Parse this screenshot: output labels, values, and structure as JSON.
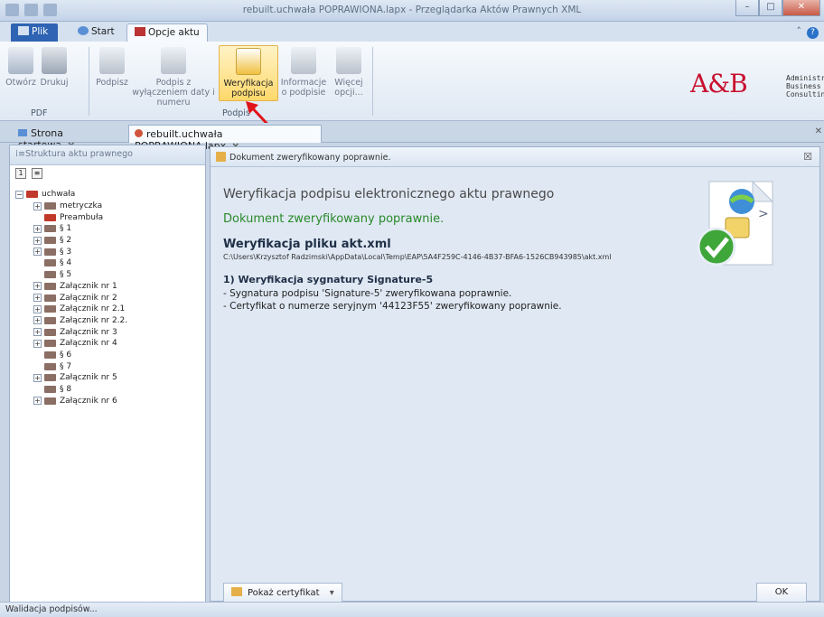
{
  "window": {
    "title": "rebuilt.uchwała POPRAWIONA.lapx - Przeglądarka Aktów Prawnych XML"
  },
  "ribbon_tabs": [
    {
      "label": "Plik"
    },
    {
      "label": "Start"
    },
    {
      "label": "Opcje aktu"
    }
  ],
  "ribbon": {
    "buttons": [
      {
        "label": "Otwórz"
      },
      {
        "label": "Drukuj"
      },
      {
        "label": "Podpisz"
      },
      {
        "label": "Podpis z wyłączeniem daty i numeru"
      },
      {
        "label": "Weryfikacja podpisu"
      },
      {
        "label": "Informacje o podpisie"
      },
      {
        "label": "Więcej opcji..."
      }
    ],
    "groups": {
      "pdf": "PDF",
      "podpis": "Podpis"
    }
  },
  "logo": {
    "mark": "A&B",
    "text": "Administration & Business Consulting"
  },
  "doc_tabs": [
    {
      "label": "Strona startowa"
    },
    {
      "label": "rebuilt.uchwała POPRAWIONA.lapx"
    }
  ],
  "left_panel": {
    "title": "Struktura aktu prawnego",
    "tree": [
      {
        "label": "uchwała",
        "level": 0,
        "expander": "−",
        "red": true
      },
      {
        "label": "metryczka",
        "level": 1,
        "expander": "+",
        "red": false
      },
      {
        "label": "Preambuła",
        "level": 1,
        "expander": "",
        "red": true
      },
      {
        "label": "§ 1",
        "level": 1,
        "expander": "+",
        "red": false
      },
      {
        "label": "§ 2",
        "level": 1,
        "expander": "+",
        "red": false
      },
      {
        "label": "§ 3",
        "level": 1,
        "expander": "+",
        "red": false
      },
      {
        "label": "§ 4",
        "level": 1,
        "expander": "",
        "red": false
      },
      {
        "label": "§ 5",
        "level": 1,
        "expander": "",
        "red": false
      },
      {
        "label": "Załącznik nr 1",
        "level": 1,
        "expander": "+",
        "red": false
      },
      {
        "label": "Załącznik nr 2",
        "level": 1,
        "expander": "+",
        "red": false
      },
      {
        "label": "Załącznik nr 2.1",
        "level": 1,
        "expander": "+",
        "red": false
      },
      {
        "label": "Załącznik nr 2.2.",
        "level": 1,
        "expander": "+",
        "red": false
      },
      {
        "label": "Załącznik nr 3",
        "level": 1,
        "expander": "+",
        "red": false
      },
      {
        "label": "Załącznik nr 4",
        "level": 1,
        "expander": "+",
        "red": false
      },
      {
        "label": "§ 6",
        "level": 1,
        "expander": "",
        "red": false
      },
      {
        "label": "§ 7",
        "level": 1,
        "expander": "",
        "red": false
      },
      {
        "label": "Załącznik nr 5",
        "level": 1,
        "expander": "+",
        "red": false
      },
      {
        "label": "§ 8",
        "level": 1,
        "expander": "",
        "red": false
      },
      {
        "label": "Załącznik nr 6",
        "level": 1,
        "expander": "+",
        "red": false
      }
    ]
  },
  "dialog": {
    "header": "Dokument zweryfikowany poprawnie.",
    "title": "Weryfikacja podpisu elektronicznego aktu prawnego",
    "status": "Dokument zweryfikowany poprawnie.",
    "file_heading": "Weryfikacja pliku akt.xml",
    "file_path": "C:\\Users\\Krzysztof Radzimski\\AppData\\Local\\Temp\\EAP\\5A4F259C-4146-4B37-BFA6-1526CB943985\\akt.xml",
    "sig_heading": "1) Weryfikacja sygnatury Signature-5",
    "sig_line1": " - Sygnatura podpisu 'Signature-5' zweryfikowana poprawnie.",
    "sig_line2": " - Certyfikat o numerze seryjnym '44123F55' zweryfikowany poprawnie.",
    "cert_button": "Pokaż certyfikat",
    "ok_button": "OK"
  },
  "status_bar": {
    "text": "Walidacja podpisów..."
  },
  "colors": {
    "accent": "#2e64b3",
    "ok_green": "#2a8a2a",
    "logo_red": "#c8102e"
  }
}
